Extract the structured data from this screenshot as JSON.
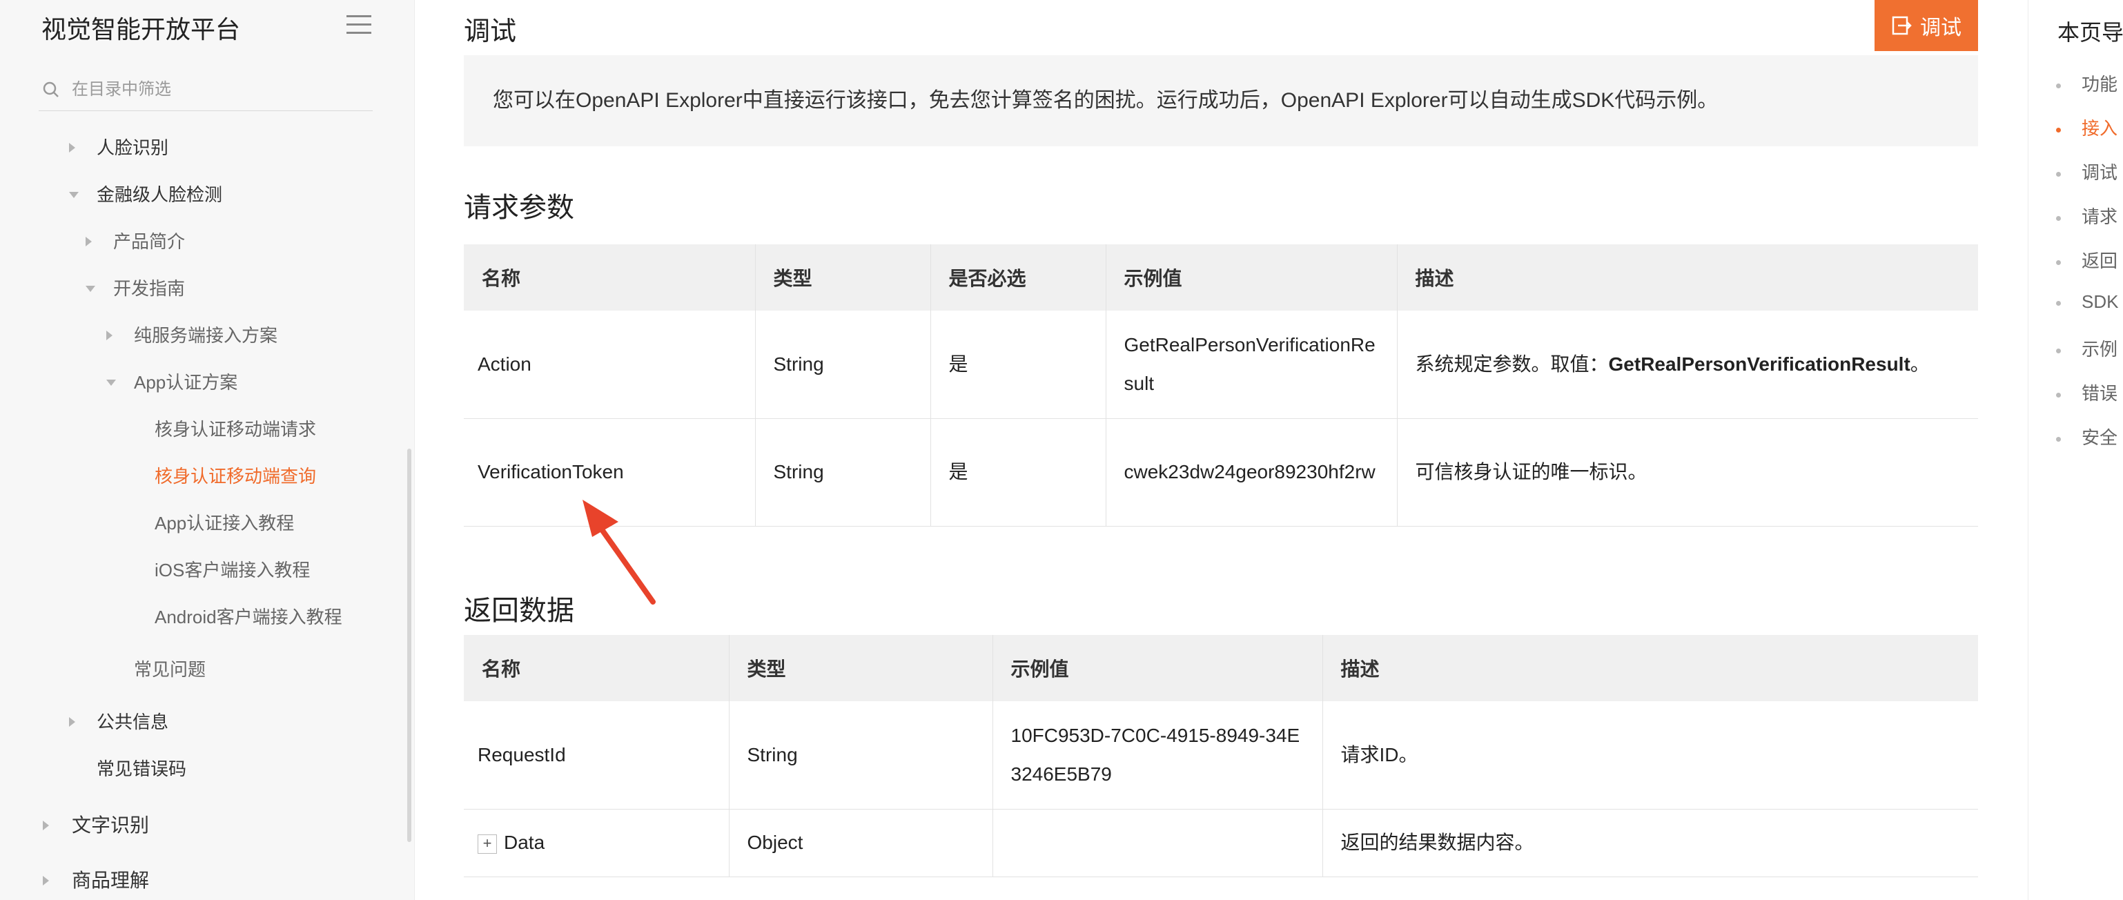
{
  "sidebar": {
    "brand": "视觉智能开放平台",
    "filter_placeholder": "在目录中筛选",
    "items": [
      {
        "label": "人脸识别"
      },
      {
        "label": "金融级人脸检测"
      },
      {
        "label": "产品简介"
      },
      {
        "label": "开发指南"
      },
      {
        "label": "纯服务端接入方案"
      },
      {
        "label": "App认证方案"
      },
      {
        "label": "核身认证移动端请求"
      },
      {
        "label": "核身认证移动端查询"
      },
      {
        "label": "App认证接入教程"
      },
      {
        "label": "iOS客户端接入教程"
      },
      {
        "label": "Android客户端接入教程"
      },
      {
        "label": "常见问题"
      },
      {
        "label": "公共信息"
      },
      {
        "label": "常见错误码"
      },
      {
        "label": "文字识别"
      },
      {
        "label": "商品理解"
      }
    ]
  },
  "main": {
    "debug_heading": "调试",
    "debug_button": "调试",
    "notice": "您可以在OpenAPI Explorer中直接运行该接口，免去您计算签名的困扰。运行成功后，OpenAPI Explorer可以自动生成SDK代码示例。",
    "request_title": "请求参数",
    "request_headers": [
      "名称",
      "类型",
      "是否必选",
      "示例值",
      "描述"
    ],
    "request_rows": [
      {
        "name": "Action",
        "type": "String",
        "required": "是",
        "example": "GetRealPersonVerificationResult",
        "desc_prefix": "系统规定参数。取值：",
        "desc_bold": "GetRealPersonVerificationResult",
        "desc_suffix": "。"
      },
      {
        "name": "VerificationToken",
        "type": "String",
        "required": "是",
        "example": "cwek23dw24geor89230hf2rw",
        "desc_prefix": "可信核身认证的唯一标识。",
        "desc_bold": "",
        "desc_suffix": ""
      }
    ],
    "response_title": "返回数据",
    "response_headers": [
      "名称",
      "类型",
      "示例值",
      "描述"
    ],
    "response_rows": [
      {
        "name": "RequestId",
        "type": "String",
        "example": "10FC953D-7C0C-4915-8949-34E3246E5B79",
        "desc": "请求ID。"
      },
      {
        "expand": "+",
        "name": "Data",
        "type": "Object",
        "example": "",
        "desc": "返回的结果数据内容。"
      }
    ]
  },
  "toc": {
    "title": "本页导",
    "items": [
      {
        "label": "功能"
      },
      {
        "label": "接入"
      },
      {
        "label": "调试"
      },
      {
        "label": "请求"
      },
      {
        "label": "返回"
      },
      {
        "label": "SDK"
      },
      {
        "label": "示例"
      },
      {
        "label": "错误"
      },
      {
        "label": "安全"
      }
    ]
  },
  "colors": {
    "accent": "#f07030",
    "active_text": "#f06b2b",
    "annotation_arrow": "#e8432b"
  }
}
